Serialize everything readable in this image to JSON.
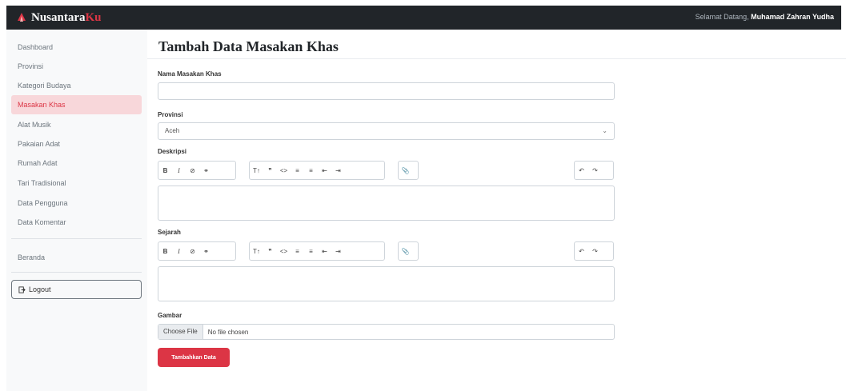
{
  "brand": {
    "name_part1": "Nusantara",
    "name_part2": "Ku"
  },
  "header": {
    "welcome_text": "Selamat Datang,",
    "user_name": "Muhamad Zahran Yudha"
  },
  "sidebar": {
    "items": [
      {
        "label": "Dashboard",
        "active": false
      },
      {
        "label": "Provinsi",
        "active": false
      },
      {
        "label": "Kategori Budaya",
        "active": false
      },
      {
        "label": "Masakan Khas",
        "active": true
      },
      {
        "label": "Alat Musik",
        "active": false
      },
      {
        "label": "Pakaian Adat",
        "active": false
      },
      {
        "label": "Rumah Adat",
        "active": false
      },
      {
        "label": "Tari Tradisional",
        "active": false
      },
      {
        "label": "Data Pengguna",
        "active": false
      },
      {
        "label": "Data Komentar",
        "active": false
      }
    ],
    "beranda_label": "Beranda",
    "logout_label": "Logout"
  },
  "page": {
    "title": "Tambah Data Masakan Khas"
  },
  "form": {
    "nama_label": "Nama Masakan Khas",
    "nama_value": "",
    "provinsi_label": "Provinsi",
    "provinsi_value": "Aceh",
    "deskripsi_label": "Deskripsi",
    "sejarah_label": "Sejarah",
    "gambar_label": "Gambar",
    "file_button_label": "Choose File",
    "file_status": "No file chosen",
    "submit_label": "Tambahkan Data"
  },
  "colors": {
    "accent": "#dc3545",
    "topbar": "#212529",
    "active_bg": "#f8d7da"
  }
}
